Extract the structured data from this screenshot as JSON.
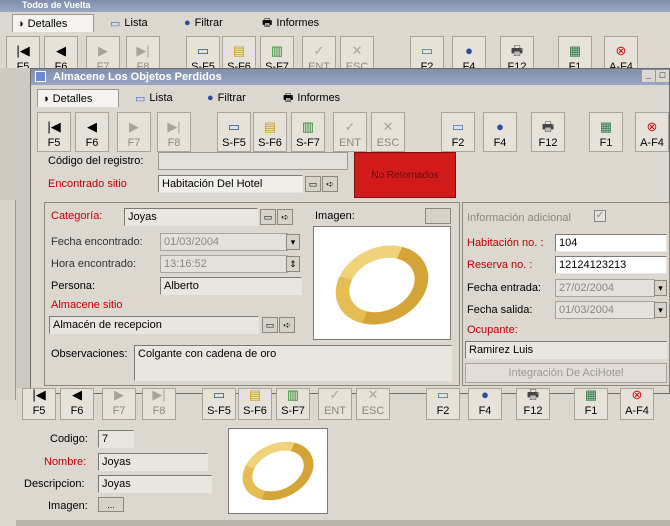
{
  "back_window": {
    "title": "Todos de Vuelta",
    "tabs": [
      "Detalles",
      "Lista",
      "Filtrar",
      "Informes"
    ],
    "toolbar_keys": [
      "F5",
      "F6",
      "F7",
      "F8",
      "S-F5",
      "S-F6",
      "S-F7",
      "ENT",
      "ESC",
      "F2",
      "F4",
      "F12",
      "F1",
      "A-F4"
    ]
  },
  "front_window": {
    "title": "Almacene Los Objetos Perdidos",
    "tabs": [
      "Detalles",
      "Lista",
      "Filtrar",
      "Informes"
    ],
    "toolbar_keys": [
      "F5",
      "F6",
      "F7",
      "F8",
      "S-F5",
      "S-F6",
      "S-F7",
      "ENT",
      "ESC",
      "F2",
      "F4",
      "F12",
      "F1",
      "A-F4"
    ],
    "registro_label": "Código del registro:",
    "registro_value": "",
    "encontrado_sitio_label": "Encontrado sitio",
    "encontrado_sitio_value": "Habitación Del Hotel",
    "status_text": "No Retornados",
    "categoria_label": "Categoría:",
    "categoria_value": "Joyas",
    "imagen_label": "Imagen:",
    "fecha_label": "Fecha encontrado:",
    "fecha_value": "01/03/2004",
    "hora_label": "Hora encontrado:",
    "hora_value": "13:16:52",
    "persona_label": "Persona:",
    "persona_value": "Alberto",
    "almacene_sitio_label": "Almacene sitio",
    "almacene_sitio_value": "Almacén de recepcion",
    "observaciones_label": "Observaciones:",
    "observaciones_value": "Colgante con cadena de oro",
    "info_adicional_label": "Información adicional",
    "habitacion_label": "Habitación no. :",
    "habitacion_value": "104",
    "reserva_label": "Reserva no. :",
    "reserva_value": "12124123213",
    "fecha_entrada_label": "Fecha entrada:",
    "fecha_entrada_value": "27/02/2004",
    "fecha_salida_label": "Fecha salida:",
    "fecha_salida_value": "01/03/2004",
    "ocupante_label": "Ocupante:",
    "ocupante_value": "Ramirez Luis",
    "integracion_label": "Integración De AciHotel"
  },
  "bottom_form": {
    "toolbar_keys": [
      "F5",
      "F6",
      "F7",
      "F8",
      "S-F5",
      "S-F6",
      "S-F7",
      "ENT",
      "ESC",
      "F2",
      "F4",
      "F12",
      "F1",
      "A-F4"
    ],
    "codigo_label": "Codigo:",
    "codigo_value": "7",
    "nombre_label": "Nombre:",
    "nombre_value": "Joyas",
    "descripcion_label": "Descripcion:",
    "descripcion_value": "Joyas",
    "imagen_label": "Imagen:",
    "imagen_button": "..."
  },
  "colors": {
    "status_red": "#d11a1a",
    "label_red": "#c00000",
    "title_bar": "#8a98b8"
  }
}
